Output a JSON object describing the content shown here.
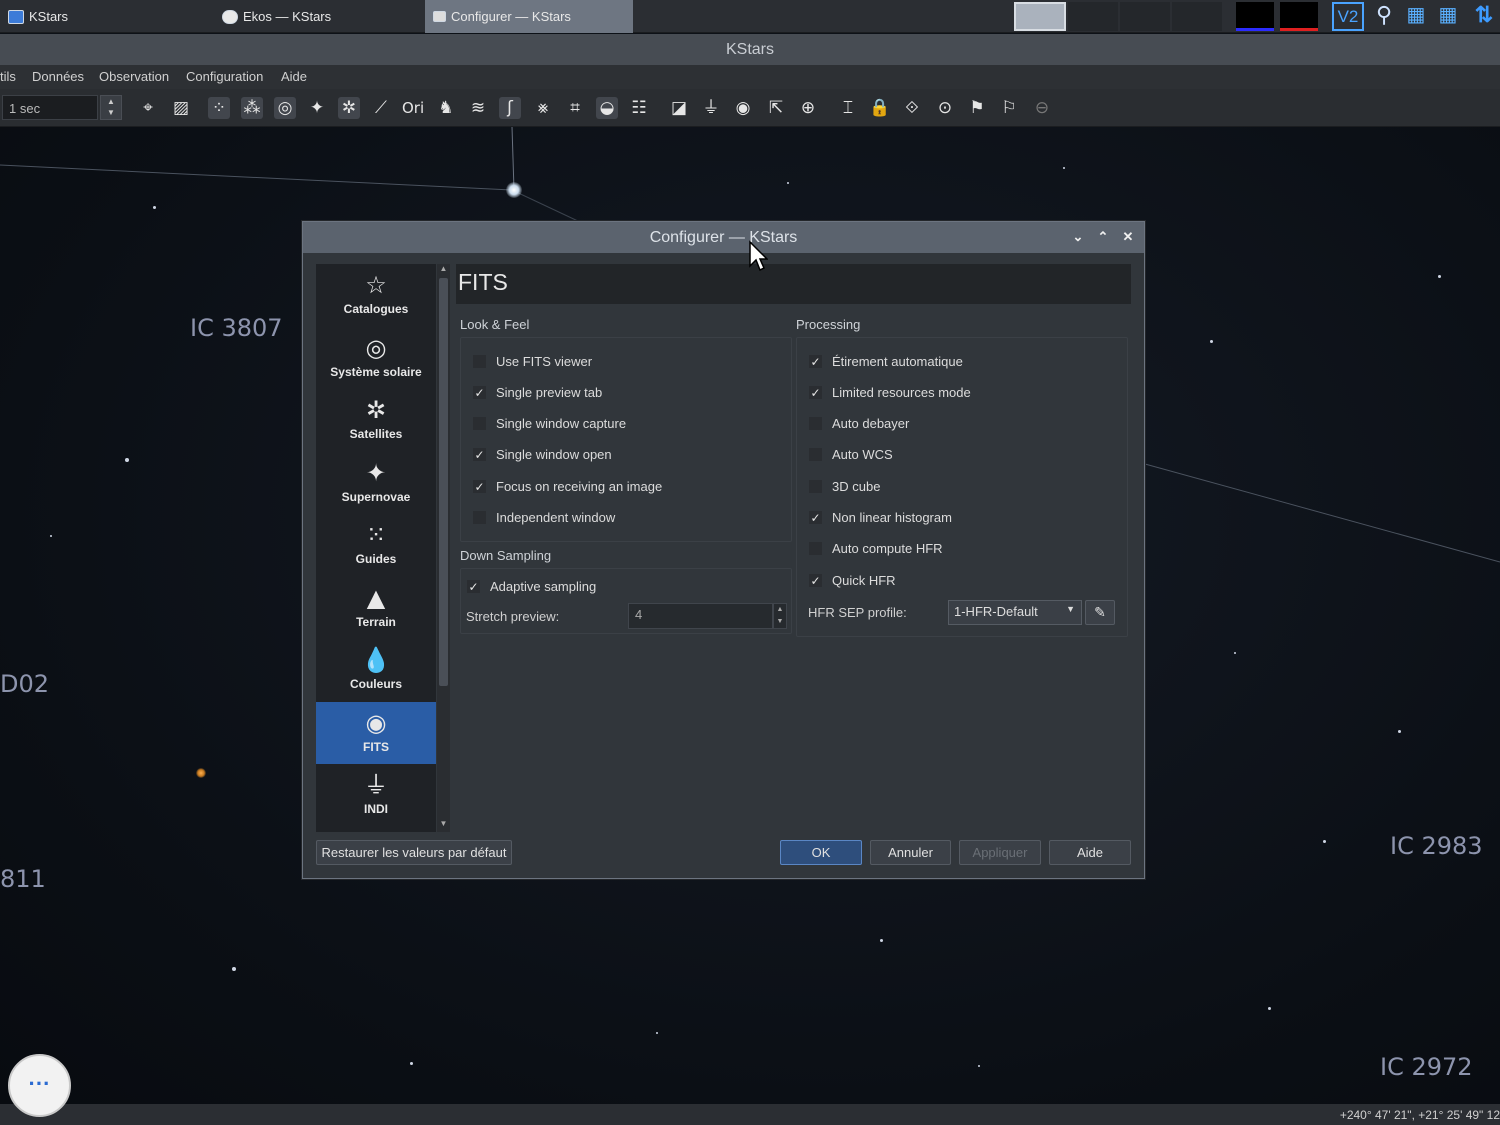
{
  "taskbar": {
    "tasks": [
      {
        "label": "KStars"
      },
      {
        "label": "Ekos — KStars"
      },
      {
        "label": "Configurer — KStars"
      }
    ]
  },
  "window": {
    "title": "KStars"
  },
  "menu": {
    "items": [
      "tils",
      "Données",
      "Observation",
      "Configuration",
      "Aide"
    ]
  },
  "toolbar": {
    "time_step": "1 sec"
  },
  "sky": {
    "labels": [
      "IC 3807",
      "D02",
      "811",
      "IC 2983",
      "IC 2972"
    ],
    "coords": "+240° 47' 21\", +21° 25' 49\"  12"
  },
  "dialog": {
    "title": "Configurer — KStars",
    "sidebar": [
      {
        "label": "Catalogues",
        "icon": "star-outline-icon"
      },
      {
        "label": "Système solaire",
        "icon": "solar-system-icon"
      },
      {
        "label": "Satellites",
        "icon": "satellite-icon"
      },
      {
        "label": "Supernovae",
        "icon": "supernova-icon"
      },
      {
        "label": "Guides",
        "icon": "guides-grid-icon"
      },
      {
        "label": "Terrain",
        "icon": "terrain-icon"
      },
      {
        "label": "Couleurs",
        "icon": "color-drop-icon"
      },
      {
        "label": "FITS",
        "icon": "galaxy-icon",
        "selected": true
      },
      {
        "label": "INDI",
        "icon": "indi-icon"
      }
    ],
    "page_title": "FITS",
    "look_feel": {
      "title": "Look & Feel",
      "options": [
        {
          "label": "Use FITS viewer",
          "checked": false
        },
        {
          "label": "Single preview tab",
          "checked": true
        },
        {
          "label": "Single window capture",
          "checked": false
        },
        {
          "label": "Single window open",
          "checked": true
        },
        {
          "label": "Focus on receiving an image",
          "checked": true
        },
        {
          "label": "Independent window",
          "checked": false
        }
      ]
    },
    "down_sampling": {
      "title": "Down Sampling",
      "adaptive": {
        "label": "Adaptive sampling",
        "checked": true
      },
      "stretch_label": "Stretch preview:",
      "stretch_value": "4"
    },
    "processing": {
      "title": "Processing",
      "options": [
        {
          "label": "Étirement automatique",
          "checked": true
        },
        {
          "label": "Limited resources mode",
          "checked": true
        },
        {
          "label": "Auto debayer",
          "checked": false
        },
        {
          "label": "Auto WCS",
          "checked": false
        },
        {
          "label": "3D cube",
          "checked": false
        },
        {
          "label": "Non linear histogram",
          "checked": true
        },
        {
          "label": "Auto compute HFR",
          "checked": false
        },
        {
          "label": "Quick HFR",
          "checked": true
        }
      ],
      "hfr_label": "HFR SEP profile:",
      "hfr_value": "1-HFR-Default"
    },
    "buttons": {
      "restore": "Restaurer les valeurs par défaut",
      "ok": "OK",
      "cancel": "Annuler",
      "apply": "Appliquer",
      "help": "Aide"
    }
  },
  "colors": {
    "accent": "#2a5da6",
    "dialog_bg": "#31363b",
    "titlebar": "#5b636e"
  }
}
